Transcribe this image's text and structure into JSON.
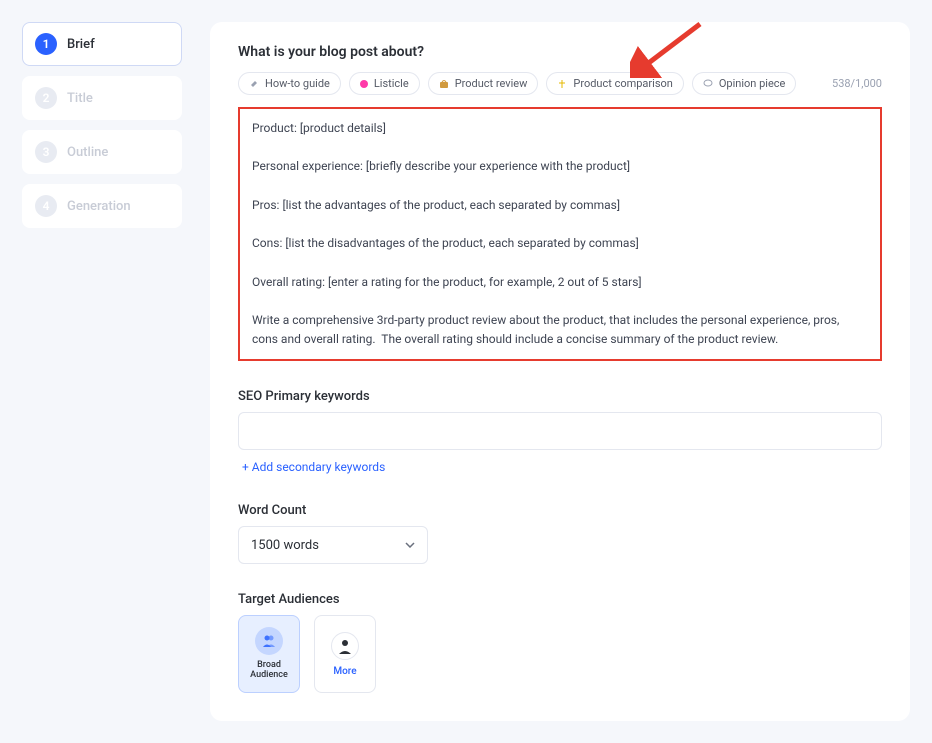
{
  "sidebar": {
    "steps": [
      {
        "num": "1",
        "label": "Brief"
      },
      {
        "num": "2",
        "label": "Title"
      },
      {
        "num": "3",
        "label": "Outline"
      },
      {
        "num": "4",
        "label": "Generation"
      }
    ]
  },
  "header": {
    "question": "What is your blog post about?",
    "chips": {
      "howto": "How-to guide",
      "listicle": "Listicle",
      "review": "Product review",
      "comparison": "Product comparison",
      "opinion": "Opinion piece"
    },
    "counter": "538/1,000"
  },
  "brief_text": "Product: [product details]\n\nPersonal experience: [briefly describe your experience with the product]\n\nPros: [list the advantages of the product, each separated by commas]\n\nCons: [list the disadvantages of the product, each separated by commas]\n\nOverall rating: [enter a rating for the product, for example, 2 out of 5 stars]\n\nWrite a comprehensive 3rd-party product review about the product, that includes the personal experience, pros, cons and overall rating.  The overall rating should include a concise summary of the product review.",
  "seo": {
    "label": "SEO Primary keywords",
    "add_link": "+ Add secondary keywords"
  },
  "wordcount": {
    "label": "Word Count",
    "selected": "1500 words"
  },
  "audience": {
    "label": "Target Audiences",
    "broad": "Broad Audience",
    "more": "More"
  }
}
